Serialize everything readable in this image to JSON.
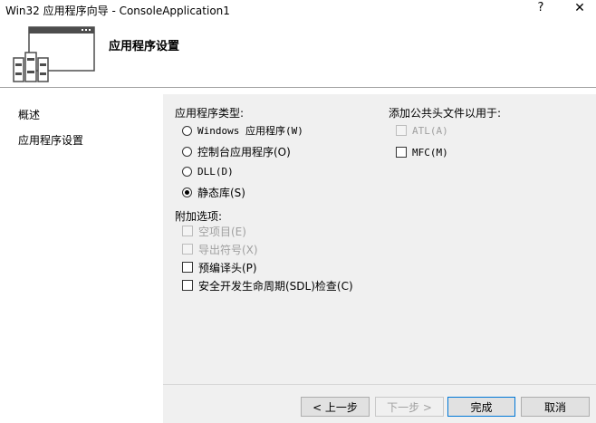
{
  "window": {
    "title": "Win32 应用程序向导 - ConsoleApplication1",
    "help_symbol": "?",
    "close_symbol": "✕"
  },
  "header": {
    "title": "应用程序设置",
    "icon": "wizard-books-window-icon"
  },
  "sidebar": {
    "items": [
      {
        "label": "概述"
      },
      {
        "label": "应用程序设置"
      }
    ]
  },
  "app_type": {
    "label": "应用程序类型:",
    "options": [
      {
        "label": "Windows 应用程序(W)",
        "checked": false
      },
      {
        "label": "控制台应用程序(O)",
        "checked": false
      },
      {
        "label": "DLL(D)",
        "checked": false
      },
      {
        "label": "静态库(S)",
        "checked": true
      }
    ]
  },
  "extra_options": {
    "label": "附加选项:",
    "items": [
      {
        "label": "空项目(E)",
        "checked": false,
        "disabled": true
      },
      {
        "label": "导出符号(X)",
        "checked": false,
        "disabled": true
      },
      {
        "label": "预编译头(P)",
        "checked": false,
        "disabled": false
      },
      {
        "label": "安全开发生命周期(SDL)检查(C)",
        "checked": false,
        "disabled": false
      }
    ]
  },
  "headers_for": {
    "label": "添加公共头文件以用于:",
    "items": [
      {
        "label": "ATL(A)",
        "checked": false,
        "disabled": true
      },
      {
        "label": "MFC(M)",
        "checked": false,
        "disabled": false
      }
    ]
  },
  "buttons": {
    "prev": "< 上一步",
    "next": "下一步 >",
    "finish": "完成",
    "cancel": "取消"
  }
}
